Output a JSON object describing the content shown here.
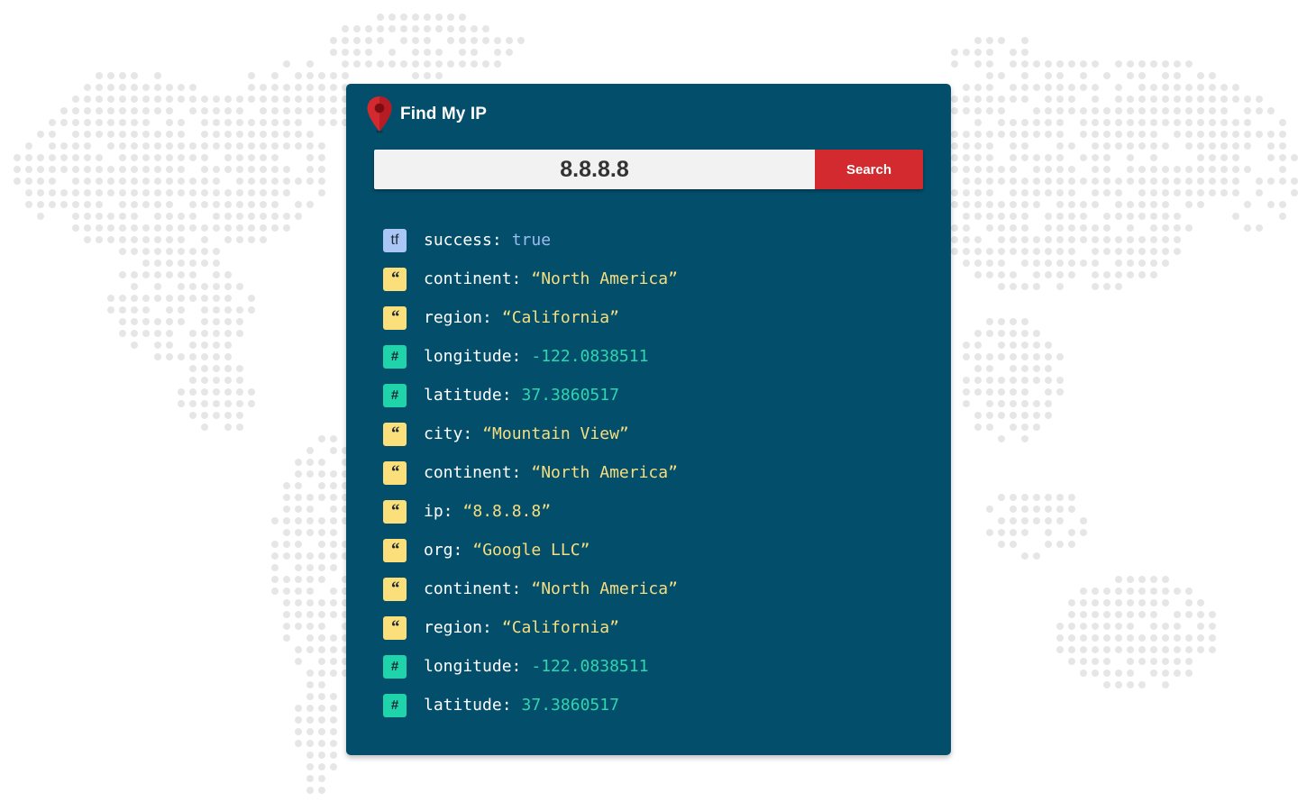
{
  "app": {
    "title": "Find My IP",
    "logo_icon": "map-pin-icon"
  },
  "search": {
    "value": "8.8.8.8",
    "button_label": "Search"
  },
  "results": [
    {
      "type": "boolean",
      "badge": "tf",
      "key": "success:",
      "value": "true"
    },
    {
      "type": "string",
      "badge": "“",
      "key": "continent:",
      "value": "“North America”"
    },
    {
      "type": "string",
      "badge": "“",
      "key": "region:",
      "value": "“California”"
    },
    {
      "type": "number",
      "badge": "#",
      "key": "longitude:",
      "value": "-122.0838511"
    },
    {
      "type": "number",
      "badge": "#",
      "key": "latitude:",
      "value": "37.3860517"
    },
    {
      "type": "string",
      "badge": "“",
      "key": "city:",
      "value": "“Mountain View”"
    },
    {
      "type": "string",
      "badge": "“",
      "key": "continent:",
      "value": "“North America”"
    },
    {
      "type": "string",
      "badge": "“",
      "key": "ip:",
      "value": "“8.8.8.8”"
    },
    {
      "type": "string",
      "badge": "“",
      "key": "org:",
      "value": "“Google LLC”"
    },
    {
      "type": "string",
      "badge": "“",
      "key": "continent:",
      "value": "“North America”"
    },
    {
      "type": "string",
      "badge": "“",
      "key": "region:",
      "value": "“California”"
    },
    {
      "type": "number",
      "badge": "#",
      "key": "longitude:",
      "value": "-122.0838511"
    },
    {
      "type": "number",
      "badge": "#",
      "key": "latitude:",
      "value": "37.3860517"
    }
  ],
  "colors": {
    "card_background": "#034e6b",
    "search_button": "#d32a2f",
    "pin": "#d32a2f",
    "badge_boolean": "#a9c6f5",
    "badge_string": "#fbdf7a",
    "badge_number": "#1fd3aa",
    "value_boolean": "#9cbcf0",
    "value_string": "#f8de7e",
    "value_number": "#2ed6ae",
    "map_dots": "#e6e6e6"
  },
  "background": {
    "icon": "dotted-world-map"
  }
}
